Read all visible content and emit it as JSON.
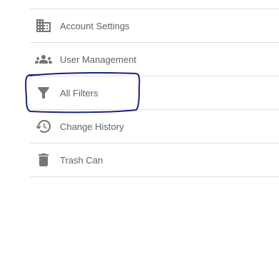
{
  "menu": {
    "items": [
      {
        "label": "Account Settings",
        "icon": "building-icon"
      },
      {
        "label": "User Management",
        "icon": "people-icon"
      },
      {
        "label": "All Filters",
        "icon": "filter-icon"
      },
      {
        "label": "Change History",
        "icon": "history-icon"
      },
      {
        "label": "Trash Can",
        "icon": "trash-icon"
      }
    ]
  },
  "colors": {
    "icon": "#757575",
    "label": "#5f6368",
    "divider": "#e0e0e0",
    "annotation": "#1a237e"
  }
}
